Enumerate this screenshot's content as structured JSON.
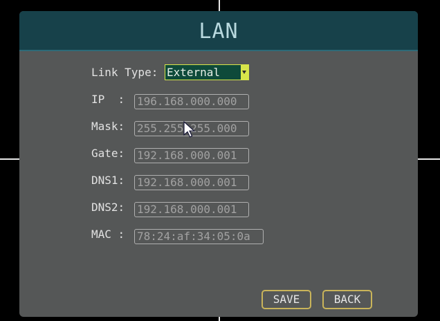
{
  "window": {
    "title": "LAN"
  },
  "form": {
    "link_type": {
      "label": "Link Type:",
      "value": "External"
    },
    "ip": {
      "label": "IP  :",
      "value": "196.168.000.000"
    },
    "mask": {
      "label": "Mask:",
      "value": "255.255.255.000"
    },
    "gate": {
      "label": "Gate:",
      "value": "192.168.000.001"
    },
    "dns1": {
      "label": "DNS1:",
      "value": "192.168.000.001"
    },
    "dns2": {
      "label": "DNS2:",
      "value": "192.168.000.001"
    },
    "mac": {
      "label": "MAC :",
      "value": "78:24:af:34:05:0a"
    }
  },
  "buttons": {
    "save": "SAVE",
    "back": "BACK"
  },
  "colors": {
    "title_bar": "#17414a",
    "panel": "#555757",
    "select_border": "#d8e64a",
    "button_border": "#c9b45a"
  },
  "icons": {
    "cursor": "mouse-pointer-icon",
    "dropdown": "chevron-down-icon"
  }
}
